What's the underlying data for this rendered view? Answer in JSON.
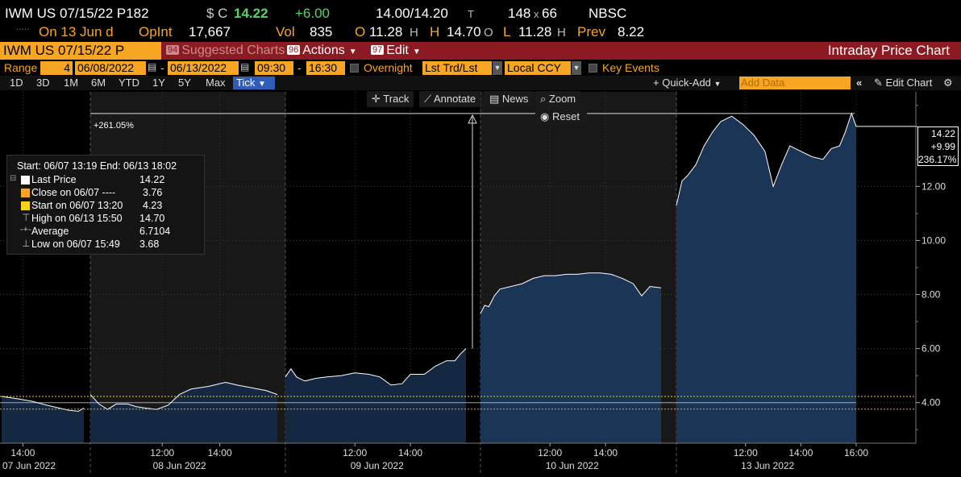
{
  "header": {
    "ticker": "IWM US 07/15/22 P182",
    "currency": "$ C",
    "last": "14.22",
    "change": "+6.00",
    "bid_ask": "14.00/14.20",
    "bid_ask_suffix": "T",
    "size": "148",
    "size_x": "x",
    "size2": "66",
    "exchange": "NBSC",
    "dots": ".....",
    "on_label": "On 13 Jun d",
    "opint_label": "OpInt",
    "opint": "17,667",
    "vol_label": "Vol",
    "vol": "835",
    "open_label": "O",
    "open": "11.28",
    "open_suffix": "H",
    "high_label": "H",
    "high": "14.70",
    "high_suffix": "O",
    "low_label": "L",
    "low": "11.28",
    "low_suffix": "H",
    "prev_label": "Prev",
    "prev": "8.22"
  },
  "titlebar": {
    "ticker": "IWM US 07/15/22 P",
    "suggested_num": "94",
    "suggested": "Suggested Charts",
    "actions_num": "96",
    "actions": "Actions",
    "edit_num": "97",
    "edit": "Edit",
    "title": "Intraday Price Chart"
  },
  "range": {
    "label": "Range",
    "count": "4",
    "start": "06/08/2022",
    "dash": "-",
    "end": "06/13/2022",
    "time_start": "09:30",
    "time_end": "16:30",
    "overnight": "Overnight",
    "lst_trd": "Lst Trd/Lst P:",
    "ccy": "Local CCY",
    "key_events": "Key Events"
  },
  "periods": [
    "1D",
    "3D",
    "1M",
    "6M",
    "YTD",
    "1Y",
    "5Y",
    "Max"
  ],
  "tick": "Tick",
  "quick_add": "Quick-Add",
  "add_data_placeholder": "Add Data",
  "edit_chart": "Edit Chart",
  "tools": {
    "track": "Track",
    "annotate": "Annotate",
    "news": "News",
    "zoom": "Zoom",
    "reset": "Reset"
  },
  "annotation_pct": "+261.05%",
  "last_tag": {
    "price": "14.22",
    "change": "+9.99",
    "pct": "236.17%"
  },
  "legend": {
    "header": "Start: 06/07 13:19 End: 06/13 18:02",
    "rows": [
      {
        "label": "Last Price",
        "value": "14.22"
      },
      {
        "label": "Close on 06/07 ----",
        "value": "3.76"
      },
      {
        "label": "Start on 06/07 13:20",
        "value": "4.23"
      },
      {
        "label": "High on 06/13 15:50",
        "value": "14.70"
      },
      {
        "label": "Average",
        "value": "6.7104"
      },
      {
        "label": "Low on 06/07 15:49",
        "value": "3.68"
      }
    ]
  },
  "colors": {
    "amber": "#f6a623",
    "fill": "#1b3556",
    "fill_alt": "#142842",
    "line": "#ffffff",
    "title_bar": "#8b1a22",
    "tick_active": "#2f5db8"
  },
  "chart_data": {
    "type": "area",
    "ylim": [
      2.5,
      15.5
    ],
    "yticks": [
      "12.00",
      "10.00",
      "8.00",
      "6.00",
      "4.00"
    ],
    "ytick_values": [
      12,
      10,
      8,
      6,
      4
    ],
    "x_time_labels": [
      "14:00",
      "12:00",
      "14:00",
      "12:00",
      "14:00",
      "12:00",
      "14:00",
      "12:00",
      "14:00",
      "16:00"
    ],
    "x_day_labels": [
      "07 Jun 2022",
      "08 Jun 2022",
      "09 Jun 2022",
      "10 Jun 2022",
      "13 Jun 2022"
    ],
    "reference_lines": [
      4.23,
      3.76
    ],
    "days": [
      {
        "date": "07 Jun 2022",
        "points": [
          [
            13.3,
            4.23
          ],
          [
            13.8,
            4.15
          ],
          [
            14.3,
            4.05
          ],
          [
            14.8,
            3.9
          ],
          [
            15.5,
            3.72
          ],
          [
            15.82,
            3.68
          ],
          [
            16.0,
            3.8
          ]
        ]
      },
      {
        "date": "08 Jun 2022",
        "points": [
          [
            9.5,
            4.3
          ],
          [
            9.8,
            3.95
          ],
          [
            10.1,
            3.75
          ],
          [
            10.4,
            3.95
          ],
          [
            10.8,
            3.95
          ],
          [
            11.1,
            3.85
          ],
          [
            11.4,
            3.8
          ],
          [
            11.8,
            3.75
          ],
          [
            12.2,
            3.9
          ],
          [
            12.6,
            4.3
          ],
          [
            13.0,
            4.5
          ],
          [
            13.6,
            4.6
          ],
          [
            14.2,
            4.75
          ],
          [
            14.6,
            4.65
          ],
          [
            15.1,
            4.55
          ],
          [
            15.6,
            4.45
          ],
          [
            16.0,
            4.3
          ]
        ]
      },
      {
        "date": "09 Jun 2022",
        "points": [
          [
            9.5,
            4.95
          ],
          [
            9.7,
            5.25
          ],
          [
            9.9,
            4.95
          ],
          [
            10.2,
            4.8
          ],
          [
            10.6,
            4.9
          ],
          [
            11.0,
            4.95
          ],
          [
            11.5,
            5.0
          ],
          [
            12.0,
            5.1
          ],
          [
            12.5,
            5.05
          ],
          [
            12.9,
            4.95
          ],
          [
            13.3,
            4.65
          ],
          [
            13.7,
            4.7
          ],
          [
            14.0,
            5.05
          ],
          [
            14.5,
            5.05
          ],
          [
            14.9,
            5.35
          ],
          [
            15.3,
            5.55
          ],
          [
            15.6,
            5.55
          ],
          [
            15.8,
            5.8
          ],
          [
            16.0,
            6.0
          ]
        ]
      },
      {
        "date": "10 Jun 2022",
        "points": [
          [
            9.5,
            7.3
          ],
          [
            9.65,
            7.6
          ],
          [
            9.8,
            7.55
          ],
          [
            10.0,
            7.95
          ],
          [
            10.2,
            8.2
          ],
          [
            10.6,
            8.3
          ],
          [
            11.0,
            8.4
          ],
          [
            11.4,
            8.6
          ],
          [
            11.8,
            8.7
          ],
          [
            12.2,
            8.7
          ],
          [
            12.6,
            8.75
          ],
          [
            13.0,
            8.75
          ],
          [
            13.4,
            8.8
          ],
          [
            13.8,
            8.8
          ],
          [
            14.2,
            8.75
          ],
          [
            14.6,
            8.6
          ],
          [
            15.0,
            8.4
          ],
          [
            15.3,
            7.95
          ],
          [
            15.6,
            8.3
          ],
          [
            16.0,
            8.25
          ]
        ]
      },
      {
        "date": "13 Jun 2022",
        "points": [
          [
            9.5,
            11.3
          ],
          [
            9.7,
            12.2
          ],
          [
            9.9,
            12.4
          ],
          [
            10.2,
            12.8
          ],
          [
            10.5,
            13.5
          ],
          [
            10.8,
            14.0
          ],
          [
            11.1,
            14.4
          ],
          [
            11.5,
            14.6
          ],
          [
            11.9,
            14.3
          ],
          [
            12.3,
            13.9
          ],
          [
            12.7,
            13.3
          ],
          [
            13.0,
            12.0
          ],
          [
            13.3,
            12.8
          ],
          [
            13.6,
            13.5
          ],
          [
            14.0,
            13.3
          ],
          [
            14.4,
            13.1
          ],
          [
            14.8,
            13.0
          ],
          [
            15.1,
            13.4
          ],
          [
            15.4,
            13.5
          ],
          [
            15.6,
            14.0
          ],
          [
            15.83,
            14.7
          ],
          [
            16.0,
            14.22
          ]
        ]
      }
    ]
  }
}
